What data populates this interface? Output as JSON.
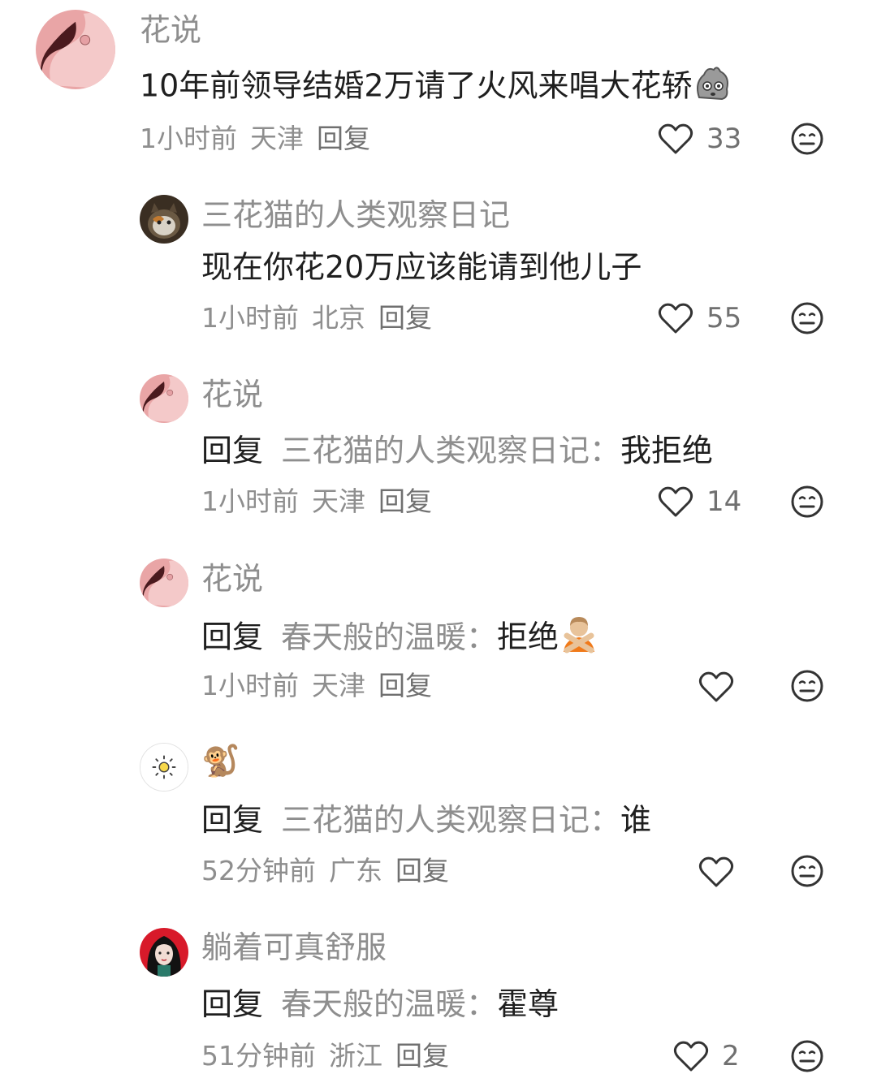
{
  "comments": [
    {
      "name": "花说",
      "text": "10年前领导结婚2万请了火风来唱大花轿",
      "time": "1小时前",
      "location": "天津",
      "reply_label": "回复",
      "likes": "33"
    },
    {
      "name": "三花猫的人类观察日记",
      "text": "现在你花20万应该能请到他儿子",
      "time": "1小时前",
      "location": "北京",
      "reply_label": "回复",
      "likes": "55"
    },
    {
      "name": "花说",
      "reply_prefix": "回复",
      "reply_target": "三花猫的人类观察日记：",
      "text": "我拒绝",
      "time": "1小时前",
      "location": "天津",
      "reply_label": "回复",
      "likes": "14"
    },
    {
      "name": "花说",
      "reply_prefix": "回复",
      "reply_target": "春天般的温暖：",
      "text": "拒绝",
      "time": "1小时前",
      "location": "天津",
      "reply_label": "回复",
      "likes": ""
    },
    {
      "name": "🐒",
      "reply_prefix": "回复",
      "reply_target": "三花猫的人类观察日记：",
      "text": "谁",
      "time": "52分钟前",
      "location": "广东",
      "reply_label": "回复",
      "likes": ""
    },
    {
      "name": "躺着可真舒服",
      "reply_prefix": "回复",
      "reply_target": "春天般的温暖：",
      "text": "霍尊",
      "time": "51分钟前",
      "location": "浙江",
      "reply_label": "回复",
      "likes": "2"
    }
  ]
}
